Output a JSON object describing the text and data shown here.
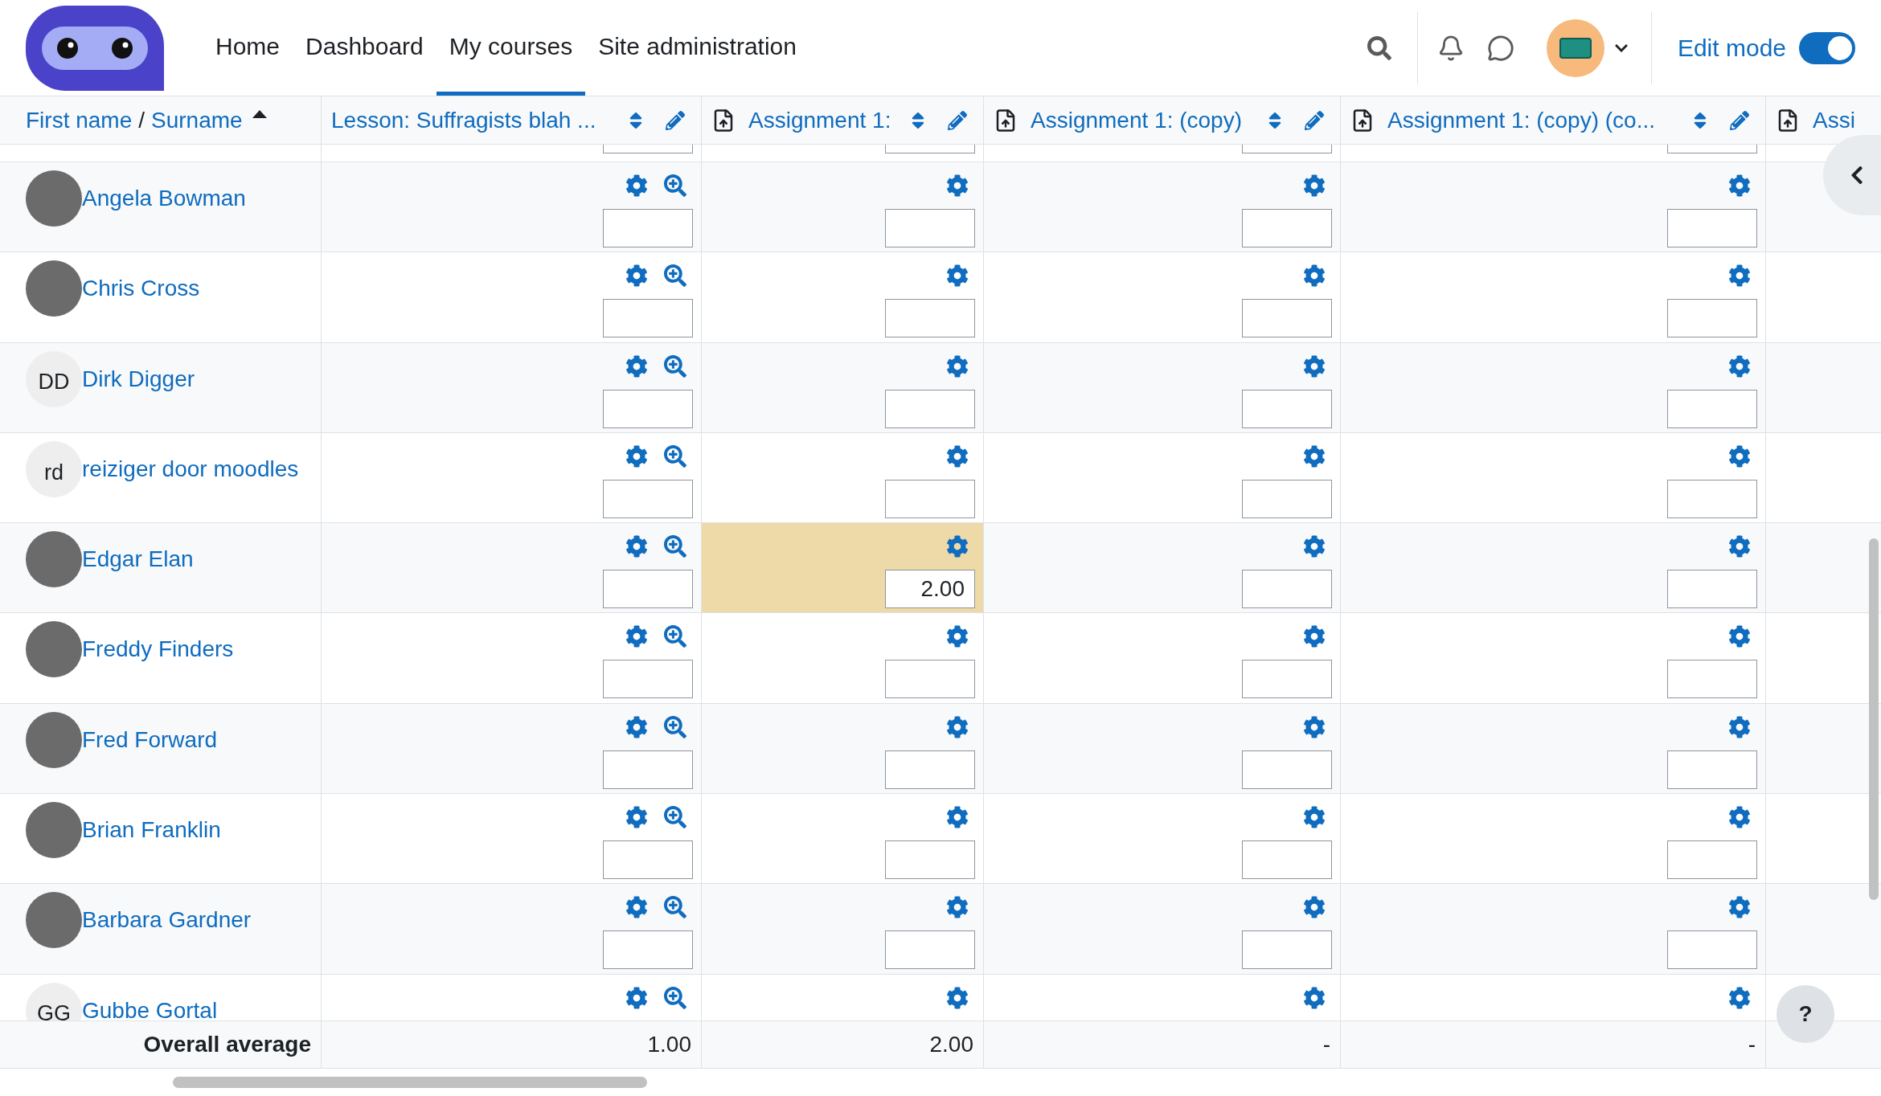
{
  "nav": {
    "items": [
      {
        "label": "Home",
        "selected": false
      },
      {
        "label": "Dashboard",
        "selected": false
      },
      {
        "label": "My courses",
        "selected": true
      },
      {
        "label": "Site administration",
        "selected": false
      }
    ],
    "edit_mode": {
      "label": "Edit mode",
      "on": true
    }
  },
  "table": {
    "name_header": {
      "first": "First name",
      "separator": "/",
      "last": "Surname"
    },
    "columns": [
      {
        "kind": "lesson",
        "title": "Lesson: Suffragists blah ..."
      },
      {
        "kind": "assignment",
        "title": "Assignment 1:"
      },
      {
        "kind": "assignment",
        "title": "Assignment 1: (copy)"
      },
      {
        "kind": "assignment",
        "title": "Assignment 1: (copy) (co..."
      },
      {
        "kind": "partial",
        "title": "Assi"
      }
    ],
    "rows": [
      {
        "name": "Angela Bowman",
        "avatar": {
          "kind": "photo"
        },
        "grades": [
          {
            "highlighted": false
          },
          {
            "highlighted": false
          },
          {
            "highlighted": false
          },
          {
            "highlighted": false
          }
        ]
      },
      {
        "name": "Chris Cross",
        "avatar": {
          "kind": "photo"
        },
        "grades": [
          {
            "highlighted": false
          },
          {
            "highlighted": false
          },
          {
            "highlighted": false
          },
          {
            "highlighted": false
          }
        ]
      },
      {
        "name": "Dirk Digger",
        "avatar": {
          "kind": "initials",
          "text": "DD"
        },
        "grades": [
          {
            "highlighted": false
          },
          {
            "highlighted": false
          },
          {
            "highlighted": false
          },
          {
            "highlighted": false
          }
        ]
      },
      {
        "name": "reiziger door moodles",
        "avatar": {
          "kind": "initials",
          "text": "rd"
        },
        "grades": [
          {
            "highlighted": false
          },
          {
            "highlighted": false
          },
          {
            "highlighted": false
          },
          {
            "highlighted": false
          }
        ]
      },
      {
        "name": "Edgar Elan",
        "avatar": {
          "kind": "photo"
        },
        "grades": [
          {
            "highlighted": false
          },
          {
            "value": "2.00",
            "highlighted": true
          },
          {
            "highlighted": false
          },
          {
            "highlighted": false
          }
        ]
      },
      {
        "name": "Freddy Finders",
        "avatar": {
          "kind": "photo"
        },
        "grades": [
          {
            "highlighted": false
          },
          {
            "highlighted": false
          },
          {
            "highlighted": false
          },
          {
            "highlighted": false
          }
        ]
      },
      {
        "name": "Fred Forward",
        "avatar": {
          "kind": "photo"
        },
        "grades": [
          {
            "highlighted": false
          },
          {
            "highlighted": false
          },
          {
            "highlighted": false
          },
          {
            "highlighted": false
          }
        ]
      },
      {
        "name": "Brian Franklin",
        "avatar": {
          "kind": "photo"
        },
        "grades": [
          {
            "highlighted": false
          },
          {
            "highlighted": false
          },
          {
            "highlighted": false
          },
          {
            "highlighted": false
          }
        ]
      },
      {
        "name": "Barbara Gardner",
        "avatar": {
          "kind": "photo"
        },
        "grades": [
          {
            "highlighted": false
          },
          {
            "highlighted": false
          },
          {
            "highlighted": false
          },
          {
            "highlighted": false
          }
        ]
      },
      {
        "name": "Gubbe Gortal",
        "avatar": {
          "kind": "initials",
          "text": "GG"
        },
        "grades": [
          {
            "highlighted": false
          },
          {
            "highlighted": false
          },
          {
            "highlighted": false
          },
          {
            "highlighted": false
          }
        ]
      }
    ],
    "average": {
      "label": "Overall average",
      "values": [
        "1.00",
        "2.00",
        "-",
        "-"
      ]
    }
  },
  "help_button": {
    "label": "?"
  }
}
